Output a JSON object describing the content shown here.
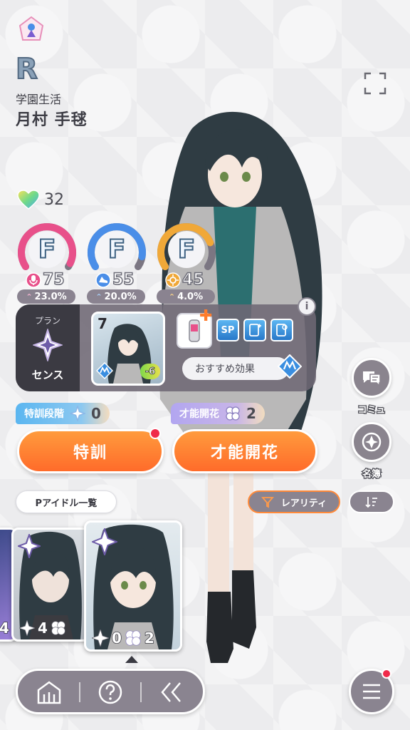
{
  "header": {
    "rarity": "R",
    "card_title": "学園生活",
    "idol_name": "月村 手毬"
  },
  "affinity": {
    "value": "32"
  },
  "parameters": [
    {
      "grade": "F",
      "value": "75",
      "bonus": "23.0%",
      "color": "#e8508a",
      "icon": "microphone-icon"
    },
    {
      "grade": "F",
      "value": "55",
      "bonus": "20.0%",
      "color": "#4a8ee8",
      "icon": "dance-shoe-icon"
    },
    {
      "grade": "F",
      "value": "45",
      "bonus": "4.0%",
      "color": "#f0a838",
      "icon": "visual-sparkle-icon"
    }
  ],
  "plan": {
    "label": "プラン",
    "name": "センス"
  },
  "support": {
    "level": "7",
    "badge": "-6",
    "chips": [
      "SP",
      "",
      ""
    ],
    "recommend_label": "おすすめ効果"
  },
  "training": {
    "label": "特訓段階",
    "count": "0",
    "button": "特訓"
  },
  "bloom": {
    "label": "才能開花",
    "count": "2",
    "button": "才能開花"
  },
  "side_buttons": {
    "commu": "コミュ",
    "meibo": "名簿"
  },
  "list_controls": {
    "idol_list": "Pアイドル一覧",
    "filter": "レアリティ"
  },
  "cards": [
    {
      "training": "4",
      "bloom": ""
    },
    {
      "training": "4",
      "bloom": ""
    },
    {
      "training": "0",
      "bloom": "2"
    }
  ],
  "colors": {
    "accent_orange": "#ff7a2e",
    "panel_gray": "#8a8490",
    "notification": "#f02a4a"
  }
}
